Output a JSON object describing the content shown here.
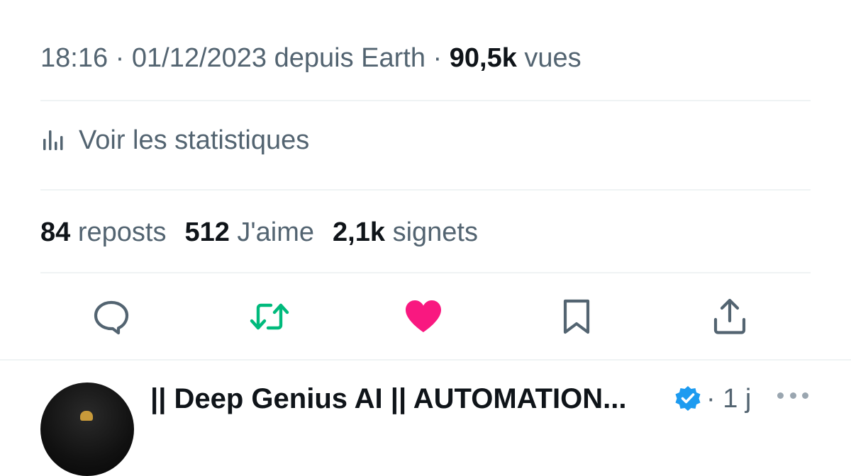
{
  "tweet_meta": {
    "time": "18:16",
    "sep1": " · ",
    "date": "01/12/2023",
    "source_prefix": " depuis ",
    "source": "Earth",
    "sep2": " · ",
    "views_count": "90,5k",
    "views_label": " vues"
  },
  "stats_link": {
    "label": "Voir les statistiques",
    "icon": "bar-chart-icon"
  },
  "engagement": {
    "reposts": {
      "count": "84",
      "label": " reposts"
    },
    "likes": {
      "count": "512",
      "label": " J'aime"
    },
    "bookmarks": {
      "count": "2,1k",
      "label": " signets"
    }
  },
  "actions": [
    {
      "name": "reply",
      "icon": "comment-icon",
      "color": "#536471"
    },
    {
      "name": "repost",
      "icon": "repost-icon",
      "color": "#00ba7c",
      "active": true
    },
    {
      "name": "like",
      "icon": "heart-icon",
      "color": "#f91880",
      "active": true
    },
    {
      "name": "bookmark",
      "icon": "bookmark-icon",
      "color": "#536471"
    },
    {
      "name": "share",
      "icon": "share-icon",
      "color": "#536471"
    }
  ],
  "reply": {
    "display_name": "|| Deep Genius AI || AUTOMATION...",
    "verified": true,
    "time_sep": "·",
    "time": "1 j",
    "more_icon": "more-horizontal-icon"
  },
  "colors": {
    "text_primary": "#0f1419",
    "text_secondary": "#536471",
    "divider": "#eff3f4",
    "verified_blue": "#1d9bf0"
  }
}
